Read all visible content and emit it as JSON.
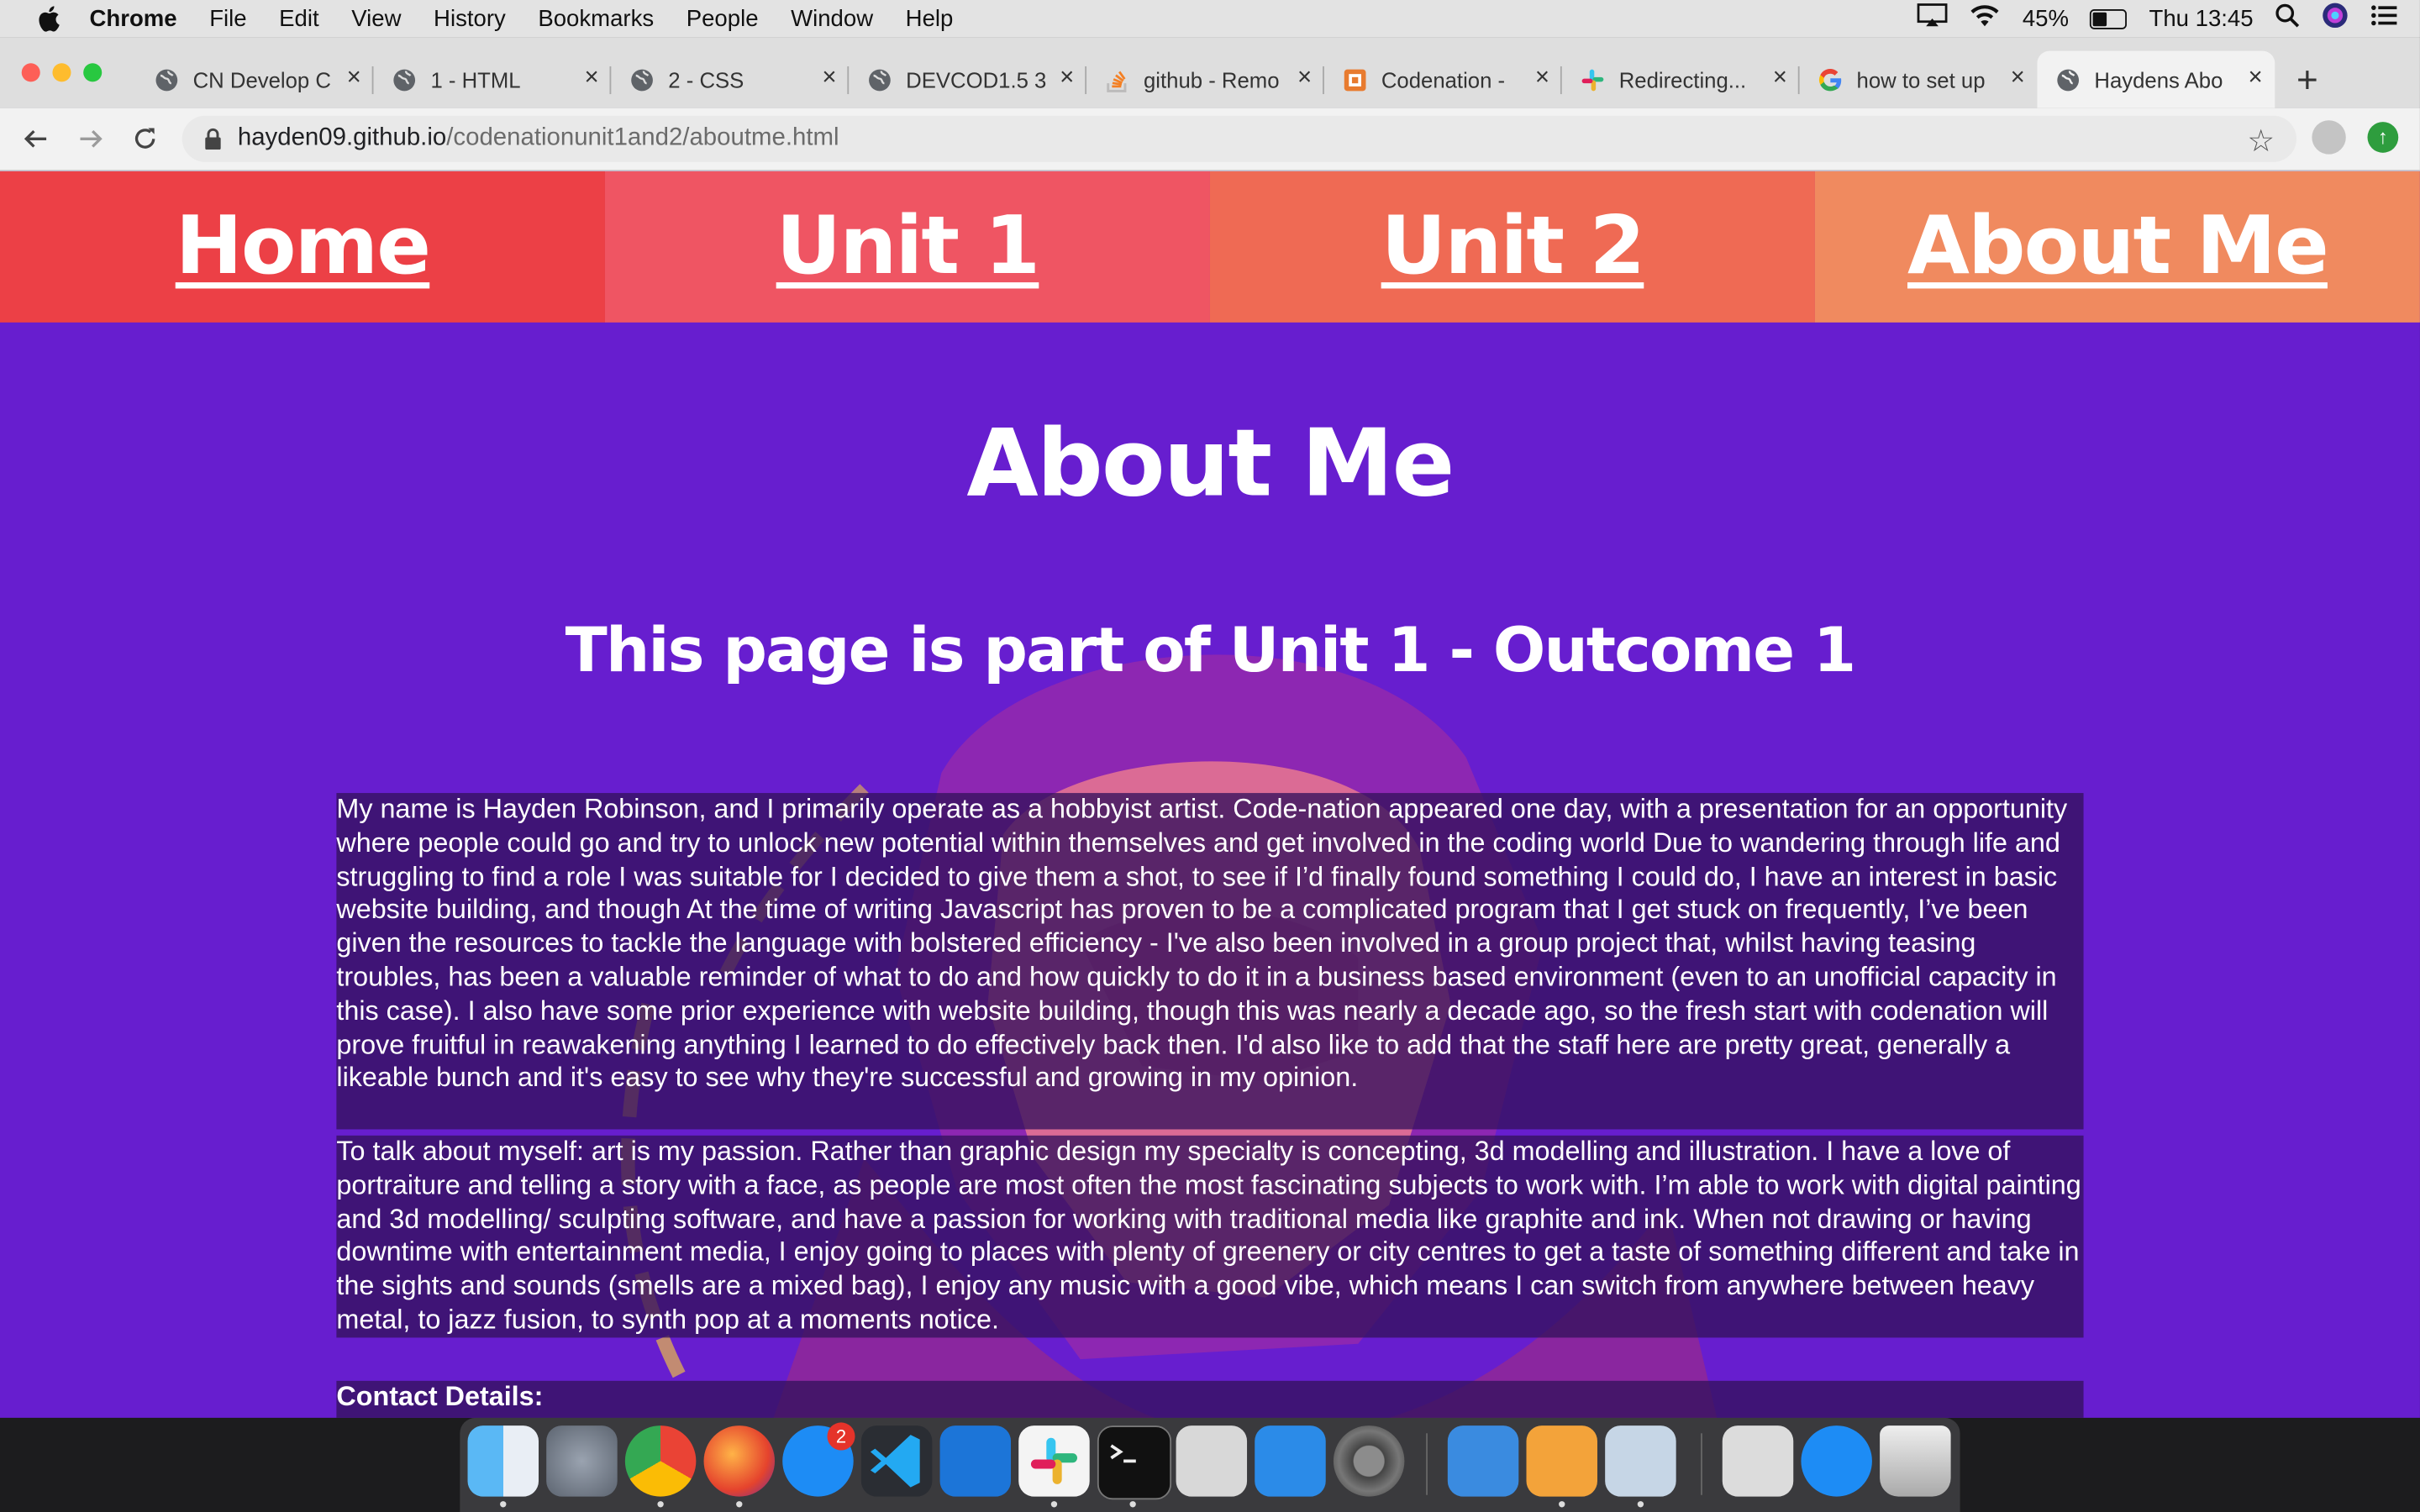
{
  "menubar": {
    "app_name": "Chrome",
    "items": [
      "File",
      "Edit",
      "View",
      "History",
      "Bookmarks",
      "People",
      "Window",
      "Help"
    ],
    "battery": "45%",
    "clock": "Thu 13:45"
  },
  "tabs": [
    {
      "title": "CN Develop C",
      "icon": "globe-icon"
    },
    {
      "title": "1 - HTML",
      "icon": "globe-icon"
    },
    {
      "title": "2 - CSS",
      "icon": "globe-icon"
    },
    {
      "title": "DEVCOD1.5 3",
      "icon": "globe-icon"
    },
    {
      "title": "github - Remo",
      "icon": "stackoverflow-icon"
    },
    {
      "title": "Codenation -",
      "icon": "codenation-icon"
    },
    {
      "title": "Redirecting...",
      "icon": "slack-icon"
    },
    {
      "title": "how to set up",
      "icon": "google-icon"
    },
    {
      "title": "Haydens Abo",
      "icon": "globe-icon",
      "active": true
    }
  ],
  "address": {
    "host": "hayden09.github.io",
    "path": "/codenationunit1and2/aboutme.html"
  },
  "nav": {
    "home": "Home",
    "unit1": "Unit 1",
    "unit2": "Unit 2",
    "about": "About Me",
    "colors": [
      "#ec4046",
      "#ef5563",
      "#ef6a54",
      "#f08a5f"
    ]
  },
  "page": {
    "title": "About Me",
    "subtitle": "This page is part of Unit 1 - Outcome 1",
    "paragraph1": "My name is Hayden Robinson, and I primarily operate as a hobbyist artist. Code-nation appeared one day, with a presentation for an opportunity where people could go and try to unlock new potential within themselves and get involved in the coding world Due to wandering through life and struggling to find a role I was suitable for I decided to give them a shot, to see if I’d finally found something I could do, I have an interest in basic website building, and though At the time of writing Javascript has proven to be a complicated program that I get stuck on frequently, I’ve been given the resources to tackle the language with bolstered efficiency - I've also been involved in a group project that, whilst having teasing troubles, has been a valuable reminder of what to do and how quickly to do it in a business based environment (even to an unofficial capacity in this case). I also have some prior experience with website building, though this was nearly a decade ago, so the fresh start with codenation will prove fruitful in reawakening anything I learned to do effectively back then. I'd also like to add that the staff here are pretty great, generally a likeable bunch and it's easy to see why they're successful and growing in my opinion.",
    "paragraph2": "To talk about myself: art is my passion. Rather than graphic design my specialty is concepting, 3d modelling and illustration. I have a love of portraiture and telling a story with a face, as people are most often the most fascinating subjects to work with. I’m able to work with digital painting and 3d modelling/ sculpting software, and have a passion for working with traditional media like graphite and ink. When not drawing or having downtime with entertainment media, I enjoy going to places with plenty of greenery or city centres to get a taste of something different and take in the sights and sounds (smells are a mixed bag), I enjoy any music with a good vibe, which means I can switch from anywhere between heavy metal, to jazz fusion, to synth pop at a moments notice.",
    "contact_heading": "Contact Details:",
    "background_color": "#671ecf"
  },
  "dock": {
    "apps": [
      "finder-icon",
      "launchpad-icon",
      "chrome-icon",
      "firefox-icon",
      "app-store-icon",
      "vscode-icon",
      "xcode-icon",
      "slack-icon",
      "terminal-icon",
      "screenshot-icon",
      "simulator-icon",
      "system-preferences-icon",
      "keynote-icon",
      "pages-icon",
      "preview-icon",
      "music-file-icon",
      "app-store-folder-icon",
      "trash-icon"
    ],
    "app_store_badge": "2"
  }
}
